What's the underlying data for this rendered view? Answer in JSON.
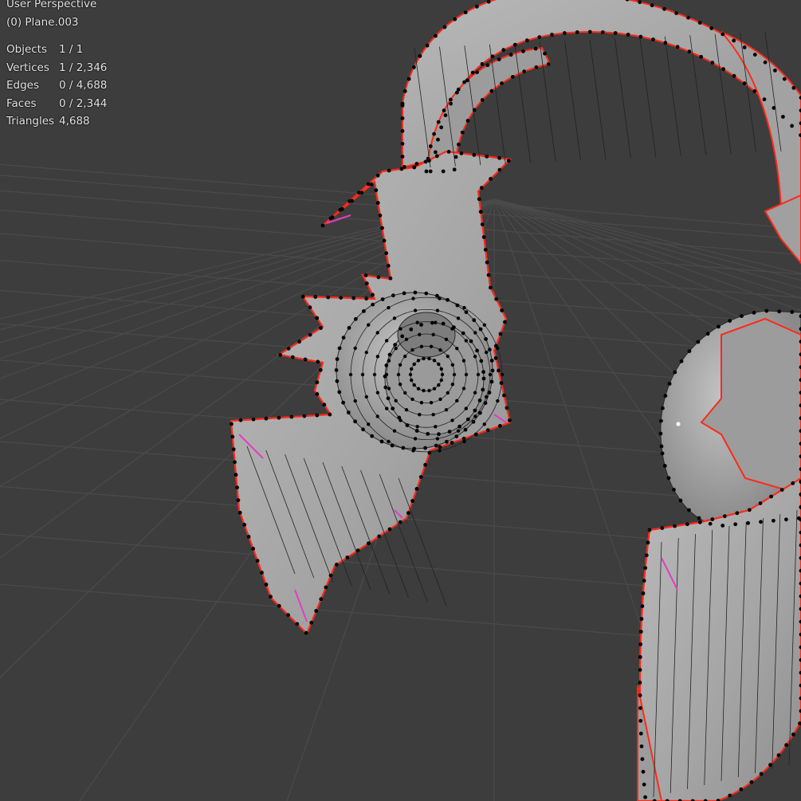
{
  "viewport": {
    "view_name": "User Perspective",
    "object_label": "(0) Plane.003",
    "stats": [
      {
        "label": "Objects",
        "value": "1 / 1"
      },
      {
        "label": "Vertices",
        "value": "1 / 2,346"
      },
      {
        "label": "Edges",
        "value": "0 / 4,688"
      },
      {
        "label": "Faces",
        "value": "0 / 2,344"
      },
      {
        "label": "Triangles",
        "value": "4,688"
      }
    ]
  },
  "colors": {
    "background": "#3d3d3d",
    "grid_line": "#4a4a4a",
    "mesh_fill": "#a9a9a9",
    "mesh_wire": "#222222",
    "vertex": "#000000",
    "seam": "#ff2a1a",
    "sharp": "#e040c0"
  }
}
